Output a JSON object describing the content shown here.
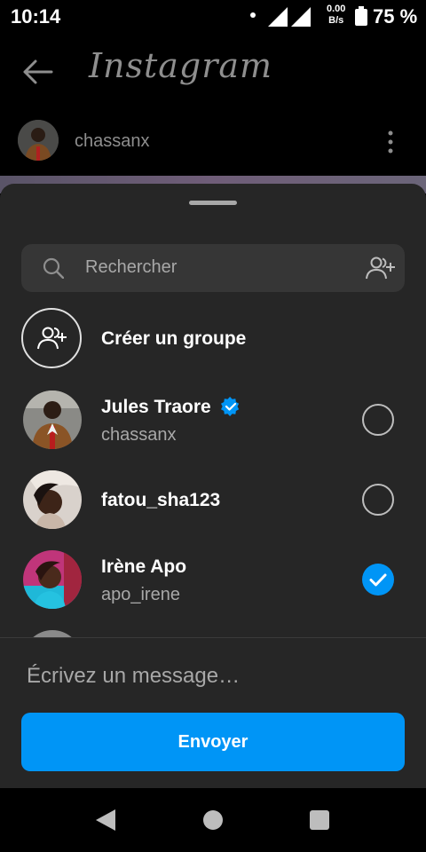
{
  "status_bar": {
    "time": "10:14",
    "net_speed_value": "0.00",
    "net_speed_unit": "B/s",
    "battery": "75 %"
  },
  "header": {
    "app_name": "Instagram",
    "username": "chassanx"
  },
  "sheet": {
    "search_placeholder": "Rechercher",
    "create_group_label": "Créer un groupe",
    "contacts": [
      {
        "name": "Jules Traore",
        "username": "chassanx",
        "verified": true,
        "selected": false
      },
      {
        "name": "fatou_sha123",
        "username": "",
        "verified": false,
        "selected": false
      },
      {
        "name": "Irène Apo",
        "username": "apo_irene",
        "verified": false,
        "selected": true
      }
    ],
    "message_placeholder": "Écrivez un message…",
    "send_label": "Envoyer"
  },
  "colors": {
    "accent": "#0095f6",
    "sheet_bg": "#262626",
    "search_bg": "#363636"
  }
}
